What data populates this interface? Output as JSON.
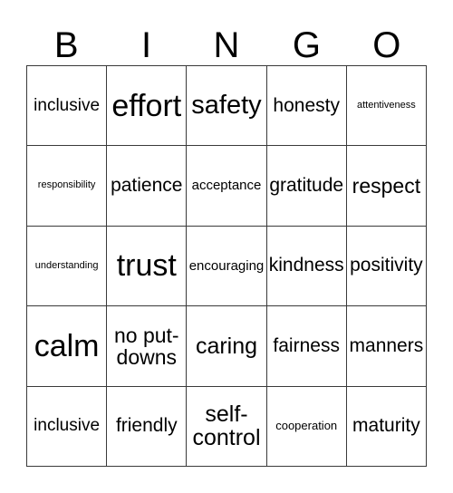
{
  "card": {
    "title": "BINGO",
    "header_letters": [
      "B",
      "I",
      "N",
      "G",
      "O"
    ],
    "grid_size": "5x5",
    "text_color": "#000000",
    "border_color": "#3a3a3a",
    "background_color": "#ffffff",
    "rows": [
      [
        {
          "text": "inclusive",
          "size": "fs-l"
        },
        {
          "text": "effort",
          "size": "fs-5xl"
        },
        {
          "text": "safety",
          "size": "fs-4xl"
        },
        {
          "text": "honesty",
          "size": "fs-xl"
        },
        {
          "text": "attentiveness",
          "size": "fs-xs"
        }
      ],
      [
        {
          "text": "responsibility",
          "size": "fs-xs"
        },
        {
          "text": "patience",
          "size": "fs-xl"
        },
        {
          "text": "acceptance",
          "size": "fs-m"
        },
        {
          "text": "gratitude",
          "size": "fs-xl"
        },
        {
          "text": "respect",
          "size": "fs-2xl"
        }
      ],
      [
        {
          "text": "understanding",
          "size": "fs-xs"
        },
        {
          "text": "trust",
          "size": "fs-5xl"
        },
        {
          "text": "encouraging",
          "size": "fs-m"
        },
        {
          "text": "kindness",
          "size": "fs-xl"
        },
        {
          "text": "positivity",
          "size": "fs-xl"
        }
      ],
      [
        {
          "text": "calm",
          "size": "fs-5xl"
        },
        {
          "text": "no put-downs",
          "size": "fs-2xl"
        },
        {
          "text": "caring",
          "size": "fs-3xl"
        },
        {
          "text": "fairness",
          "size": "fs-xl"
        },
        {
          "text": "manners",
          "size": "fs-xl"
        }
      ],
      [
        {
          "text": "inclusive",
          "size": "fs-l"
        },
        {
          "text": "friendly",
          "size": "fs-xl"
        },
        {
          "text": "self-control",
          "size": "fs-3xl"
        },
        {
          "text": "cooperation",
          "size": "fs-s"
        },
        {
          "text": "maturity",
          "size": "fs-xl"
        }
      ]
    ]
  }
}
